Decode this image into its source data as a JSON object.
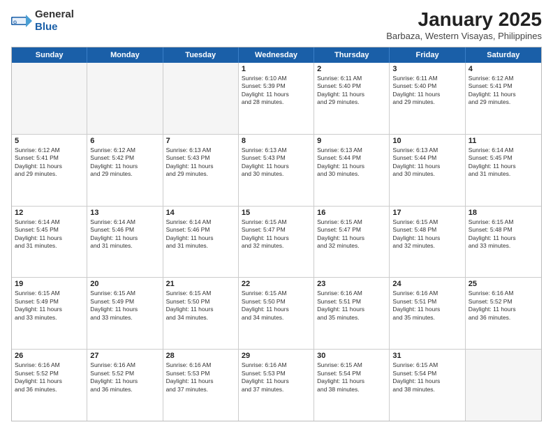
{
  "logo": {
    "general": "General",
    "blue": "Blue"
  },
  "title": "January 2025",
  "subtitle": "Barbaza, Western Visayas, Philippines",
  "header": {
    "days": [
      "Sunday",
      "Monday",
      "Tuesday",
      "Wednesday",
      "Thursday",
      "Friday",
      "Saturday"
    ]
  },
  "weeks": [
    {
      "cells": [
        {
          "day": "",
          "lines": [],
          "empty": true
        },
        {
          "day": "",
          "lines": [],
          "empty": true
        },
        {
          "day": "",
          "lines": [],
          "empty": true
        },
        {
          "day": "1",
          "lines": [
            "Sunrise: 6:10 AM",
            "Sunset: 5:39 PM",
            "Daylight: 11 hours",
            "and 28 minutes."
          ],
          "empty": false
        },
        {
          "day": "2",
          "lines": [
            "Sunrise: 6:11 AM",
            "Sunset: 5:40 PM",
            "Daylight: 11 hours",
            "and 29 minutes."
          ],
          "empty": false
        },
        {
          "day": "3",
          "lines": [
            "Sunrise: 6:11 AM",
            "Sunset: 5:40 PM",
            "Daylight: 11 hours",
            "and 29 minutes."
          ],
          "empty": false
        },
        {
          "day": "4",
          "lines": [
            "Sunrise: 6:12 AM",
            "Sunset: 5:41 PM",
            "Daylight: 11 hours",
            "and 29 minutes."
          ],
          "empty": false
        }
      ]
    },
    {
      "cells": [
        {
          "day": "5",
          "lines": [
            "Sunrise: 6:12 AM",
            "Sunset: 5:41 PM",
            "Daylight: 11 hours",
            "and 29 minutes."
          ],
          "empty": false
        },
        {
          "day": "6",
          "lines": [
            "Sunrise: 6:12 AM",
            "Sunset: 5:42 PM",
            "Daylight: 11 hours",
            "and 29 minutes."
          ],
          "empty": false
        },
        {
          "day": "7",
          "lines": [
            "Sunrise: 6:13 AM",
            "Sunset: 5:43 PM",
            "Daylight: 11 hours",
            "and 29 minutes."
          ],
          "empty": false
        },
        {
          "day": "8",
          "lines": [
            "Sunrise: 6:13 AM",
            "Sunset: 5:43 PM",
            "Daylight: 11 hours",
            "and 30 minutes."
          ],
          "empty": false
        },
        {
          "day": "9",
          "lines": [
            "Sunrise: 6:13 AM",
            "Sunset: 5:44 PM",
            "Daylight: 11 hours",
            "and 30 minutes."
          ],
          "empty": false
        },
        {
          "day": "10",
          "lines": [
            "Sunrise: 6:13 AM",
            "Sunset: 5:44 PM",
            "Daylight: 11 hours",
            "and 30 minutes."
          ],
          "empty": false
        },
        {
          "day": "11",
          "lines": [
            "Sunrise: 6:14 AM",
            "Sunset: 5:45 PM",
            "Daylight: 11 hours",
            "and 31 minutes."
          ],
          "empty": false
        }
      ]
    },
    {
      "cells": [
        {
          "day": "12",
          "lines": [
            "Sunrise: 6:14 AM",
            "Sunset: 5:45 PM",
            "Daylight: 11 hours",
            "and 31 minutes."
          ],
          "empty": false
        },
        {
          "day": "13",
          "lines": [
            "Sunrise: 6:14 AM",
            "Sunset: 5:46 PM",
            "Daylight: 11 hours",
            "and 31 minutes."
          ],
          "empty": false
        },
        {
          "day": "14",
          "lines": [
            "Sunrise: 6:14 AM",
            "Sunset: 5:46 PM",
            "Daylight: 11 hours",
            "and 31 minutes."
          ],
          "empty": false
        },
        {
          "day": "15",
          "lines": [
            "Sunrise: 6:15 AM",
            "Sunset: 5:47 PM",
            "Daylight: 11 hours",
            "and 32 minutes."
          ],
          "empty": false
        },
        {
          "day": "16",
          "lines": [
            "Sunrise: 6:15 AM",
            "Sunset: 5:47 PM",
            "Daylight: 11 hours",
            "and 32 minutes."
          ],
          "empty": false
        },
        {
          "day": "17",
          "lines": [
            "Sunrise: 6:15 AM",
            "Sunset: 5:48 PM",
            "Daylight: 11 hours",
            "and 32 minutes."
          ],
          "empty": false
        },
        {
          "day": "18",
          "lines": [
            "Sunrise: 6:15 AM",
            "Sunset: 5:48 PM",
            "Daylight: 11 hours",
            "and 33 minutes."
          ],
          "empty": false
        }
      ]
    },
    {
      "cells": [
        {
          "day": "19",
          "lines": [
            "Sunrise: 6:15 AM",
            "Sunset: 5:49 PM",
            "Daylight: 11 hours",
            "and 33 minutes."
          ],
          "empty": false
        },
        {
          "day": "20",
          "lines": [
            "Sunrise: 6:15 AM",
            "Sunset: 5:49 PM",
            "Daylight: 11 hours",
            "and 33 minutes."
          ],
          "empty": false
        },
        {
          "day": "21",
          "lines": [
            "Sunrise: 6:15 AM",
            "Sunset: 5:50 PM",
            "Daylight: 11 hours",
            "and 34 minutes."
          ],
          "empty": false
        },
        {
          "day": "22",
          "lines": [
            "Sunrise: 6:15 AM",
            "Sunset: 5:50 PM",
            "Daylight: 11 hours",
            "and 34 minutes."
          ],
          "empty": false
        },
        {
          "day": "23",
          "lines": [
            "Sunrise: 6:16 AM",
            "Sunset: 5:51 PM",
            "Daylight: 11 hours",
            "and 35 minutes."
          ],
          "empty": false
        },
        {
          "day": "24",
          "lines": [
            "Sunrise: 6:16 AM",
            "Sunset: 5:51 PM",
            "Daylight: 11 hours",
            "and 35 minutes."
          ],
          "empty": false
        },
        {
          "day": "25",
          "lines": [
            "Sunrise: 6:16 AM",
            "Sunset: 5:52 PM",
            "Daylight: 11 hours",
            "and 36 minutes."
          ],
          "empty": false
        }
      ]
    },
    {
      "cells": [
        {
          "day": "26",
          "lines": [
            "Sunrise: 6:16 AM",
            "Sunset: 5:52 PM",
            "Daylight: 11 hours",
            "and 36 minutes."
          ],
          "empty": false
        },
        {
          "day": "27",
          "lines": [
            "Sunrise: 6:16 AM",
            "Sunset: 5:52 PM",
            "Daylight: 11 hours",
            "and 36 minutes."
          ],
          "empty": false
        },
        {
          "day": "28",
          "lines": [
            "Sunrise: 6:16 AM",
            "Sunset: 5:53 PM",
            "Daylight: 11 hours",
            "and 37 minutes."
          ],
          "empty": false
        },
        {
          "day": "29",
          "lines": [
            "Sunrise: 6:16 AM",
            "Sunset: 5:53 PM",
            "Daylight: 11 hours",
            "and 37 minutes."
          ],
          "empty": false
        },
        {
          "day": "30",
          "lines": [
            "Sunrise: 6:15 AM",
            "Sunset: 5:54 PM",
            "Daylight: 11 hours",
            "and 38 minutes."
          ],
          "empty": false
        },
        {
          "day": "31",
          "lines": [
            "Sunrise: 6:15 AM",
            "Sunset: 5:54 PM",
            "Daylight: 11 hours",
            "and 38 minutes."
          ],
          "empty": false
        },
        {
          "day": "",
          "lines": [],
          "empty": true
        }
      ]
    }
  ]
}
